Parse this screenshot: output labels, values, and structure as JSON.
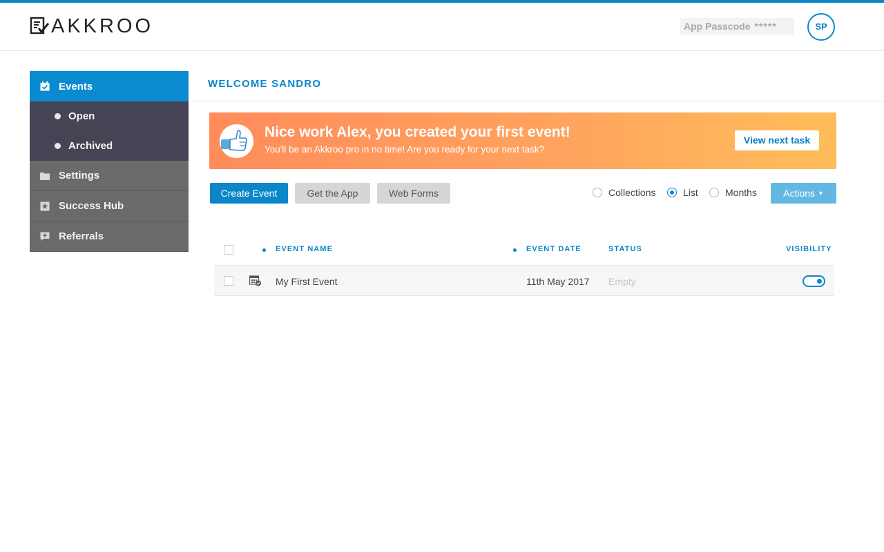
{
  "brand": {
    "name": "AKKROO",
    "accent": "#0a86c9"
  },
  "header": {
    "passcode_label": "App Passcode",
    "passcode_value": "*****",
    "avatar_initials": "SP"
  },
  "sidebar": {
    "items": [
      {
        "label": "Events",
        "icon": "calendar-check-icon",
        "active": true
      },
      {
        "label": "Open",
        "sub": true
      },
      {
        "label": "Archived",
        "sub": true
      },
      {
        "label": "Settings",
        "icon": "folder-icon"
      },
      {
        "label": "Success Hub",
        "icon": "star-box-icon"
      },
      {
        "label": "Referrals",
        "icon": "chat-plus-icon"
      }
    ]
  },
  "main": {
    "welcome": "WELCOME SANDRO",
    "banner": {
      "title": "Nice work Alex, you created your first event!",
      "subtitle": "You'll be an Akkroo pro in no time! Are you ready for your next task?",
      "button": "View next task"
    },
    "toolbar": {
      "create": "Create Event",
      "get_app": "Get the App",
      "web_forms": "Web Forms",
      "view_options": [
        "Collections",
        "List",
        "Months"
      ],
      "selected_view": "List",
      "actions": "Actions"
    },
    "table": {
      "columns": [
        "EVENT NAME",
        "EVENT DATE",
        "STATUS",
        "VISIBILITY"
      ],
      "rows": [
        {
          "name": "My First Event",
          "date": "11th May 2017",
          "status": "Empty",
          "visible": true
        }
      ]
    }
  }
}
